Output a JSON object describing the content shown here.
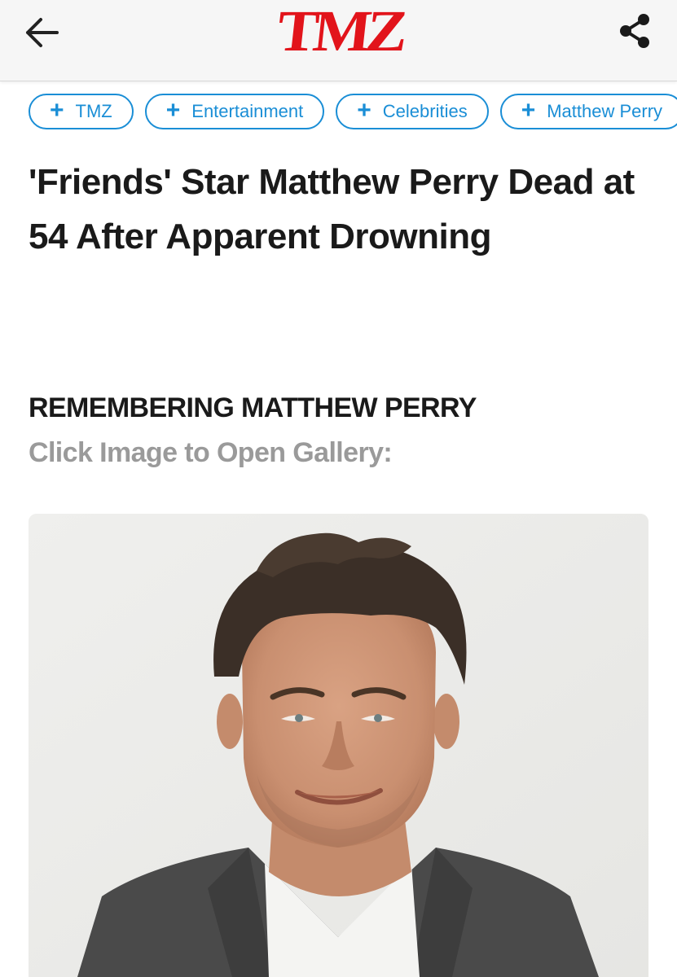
{
  "header": {
    "logo_text": "TMZ",
    "back_icon": "arrow-left-icon",
    "share_icon": "share-icon",
    "brand_color": "#e2141b"
  },
  "tags": [
    {
      "label": "TMZ"
    },
    {
      "label": "Entertainment"
    },
    {
      "label": "Celebrities"
    },
    {
      "label": "Matthew Perry"
    }
  ],
  "tag_icon": "plus-icon",
  "tag_color": "#1a8ed6",
  "article": {
    "headline": "'Friends' Star Matthew Perry Dead at 54 After Apparent Drowning"
  },
  "gallery": {
    "title": "REMEMBERING MATTHEW PERRY",
    "hint": "Click Image to Open Gallery:"
  }
}
